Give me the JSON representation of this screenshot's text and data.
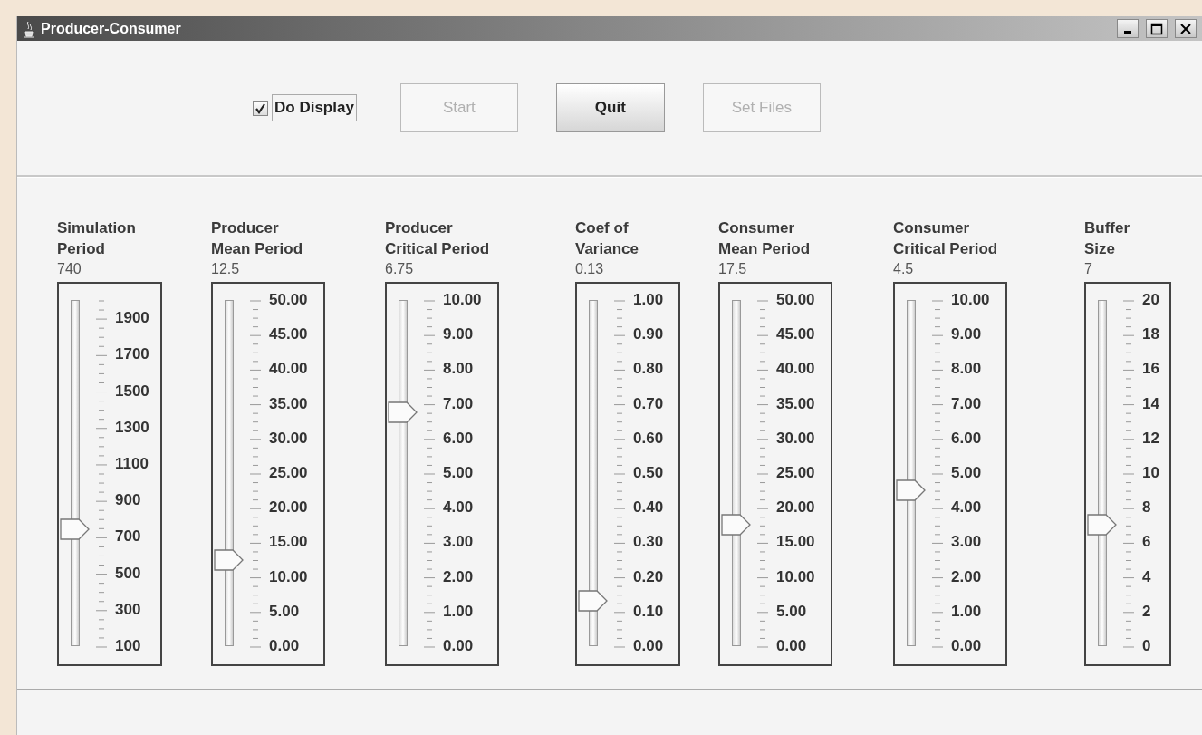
{
  "window": {
    "title": "Producer-Consumer"
  },
  "toolbar": {
    "checkbox": {
      "label": "Do Display",
      "checked": true
    },
    "buttons": [
      {
        "label": "Start",
        "disabled": true
      },
      {
        "label": "Quit",
        "disabled": false
      },
      {
        "label": "Set Files",
        "disabled": true
      }
    ]
  },
  "sliders": [
    {
      "label": "Simulation\nPeriod",
      "value": "740",
      "level": 0.337,
      "ticks": [
        "1900",
        "1700",
        "1500",
        "1300",
        "1100",
        "900",
        "700",
        "500",
        "300",
        "100"
      ]
    },
    {
      "label": "Producer\nMean Period",
      "value": "12.5",
      "level": 0.25,
      "ticks": [
        "50.00",
        "45.00",
        "40.00",
        "35.00",
        "30.00",
        "25.00",
        "20.00",
        "15.00",
        "10.00",
        "5.00",
        "0.00"
      ]
    },
    {
      "label": "Producer\nCritical Period",
      "value": "6.75",
      "level": 0.675,
      "ticks": [
        "10.00",
        "9.00",
        "8.00",
        "7.00",
        "6.00",
        "5.00",
        "4.00",
        "3.00",
        "2.00",
        "1.00",
        "0.00"
      ]
    },
    {
      "label": "Coef of\nVariance",
      "value": "0.13",
      "level": 0.13,
      "ticks": [
        "1.00",
        "0.90",
        "0.80",
        "0.70",
        "0.60",
        "0.50",
        "0.40",
        "0.30",
        "0.20",
        "0.10",
        "0.00"
      ]
    },
    {
      "label": "Consumer\nMean Period",
      "value": "17.5",
      "level": 0.35,
      "ticks": [
        "50.00",
        "45.00",
        "40.00",
        "35.00",
        "30.00",
        "25.00",
        "20.00",
        "15.00",
        "10.00",
        "5.00",
        "0.00"
      ]
    },
    {
      "label": "Consumer\nCritical Period",
      "value": "4.5",
      "level": 0.45,
      "ticks": [
        "10.00",
        "9.00",
        "8.00",
        "7.00",
        "6.00",
        "5.00",
        "4.00",
        "3.00",
        "2.00",
        "1.00",
        "0.00"
      ]
    },
    {
      "label": "Buffer\nSize",
      "value": "7",
      "level": 0.35,
      "ticks": [
        "20",
        "18",
        "16",
        "14",
        "12",
        "10",
        "8",
        "6",
        "4",
        "2",
        "0"
      ]
    }
  ]
}
